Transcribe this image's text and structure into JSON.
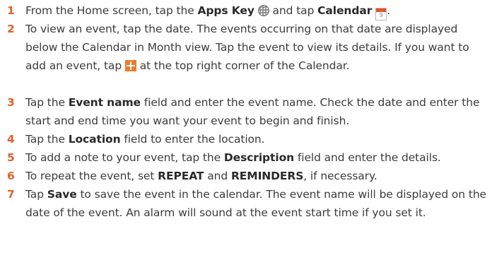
{
  "steps": [
    {
      "number": "1",
      "parts": {
        "t1": "From the Home screen, tap the ",
        "b1": "Apps Key",
        "icon_apps": "apps-key-icon",
        "t2": " and tap ",
        "b2": "Calendar",
        "icon_calendar": "calendar-icon",
        "cal_day": "9",
        "t3": "."
      }
    },
    {
      "number": "2",
      "parts": {
        "t1": "To view an event, tap the date. The events occurring on that date are displayed below the Calendar in Month view. Tap the event to view its details. If you want to add an event, tap ",
        "icon_plus": "plus-icon",
        "t2": " at the top right corner of the Calendar."
      }
    },
    {
      "number": "3",
      "parts": {
        "t1": "Tap the ",
        "b1": "Event name",
        "t2": " field and enter the event name. Check the date and enter the start and end time you want your event to begin and finish."
      }
    },
    {
      "number": "4",
      "parts": {
        "t1": "Tap the ",
        "b1": "Location",
        "t2": " field to enter the location."
      }
    },
    {
      "number": "5",
      "parts": {
        "t1": "To add a note to your event, tap the ",
        "b1": "Description",
        "t2": " field and enter the details."
      }
    },
    {
      "number": "6",
      "parts": {
        "t1": "To repeat the event, set ",
        "b1": "REPEAT",
        "t2": " and ",
        "b2": "REMINDERS",
        "t3": ", if necessary."
      }
    },
    {
      "number": "7",
      "parts": {
        "t1": "Tap ",
        "b1": "Save",
        "t2": " to save the event in the calendar. The event name will be displayed on the date of the event. An alarm will sound at the event start time if you set it."
      }
    }
  ],
  "colors": {
    "step_number": "#e3602b",
    "text": "#3c3c3c",
    "plus_icon_bg": "#ef7a2a",
    "calendar_icon_top": "#e0552a"
  }
}
